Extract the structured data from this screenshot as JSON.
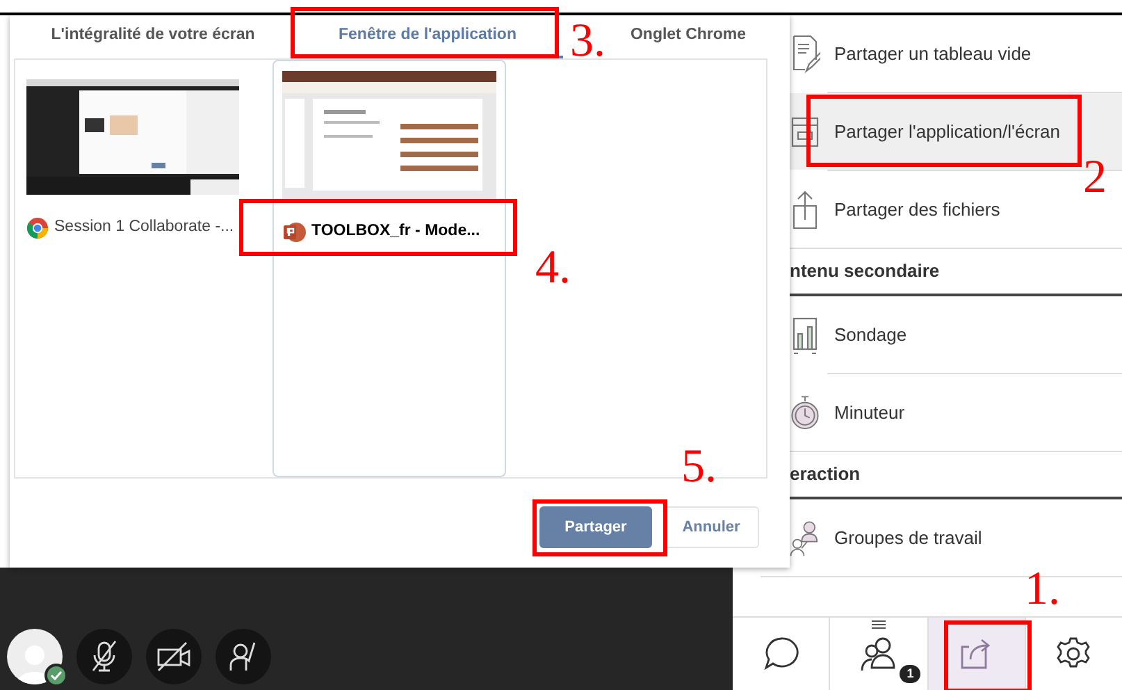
{
  "dialog": {
    "tabs": [
      {
        "label": "L'intégralité de votre écran",
        "selected": false
      },
      {
        "label": "Fenêtre de l'application",
        "selected": true
      },
      {
        "label": "Onglet Chrome",
        "selected": false
      }
    ],
    "windows": [
      {
        "kind": "chrome",
        "caption": "Session 1 Collaborate -...",
        "selected": false
      },
      {
        "kind": "powerpoint",
        "caption": "TOOLBOX_fr  -  Mode...",
        "selected": true
      }
    ],
    "buttons": [
      {
        "label": "Partager",
        "kind": "primary"
      },
      {
        "label": "Annuler",
        "kind": "secondary"
      }
    ]
  },
  "panel": {
    "items": [
      {
        "label": "Partager un tableau vide",
        "selected": false
      },
      {
        "label": "Partager l'application/l'écran",
        "selected": true
      },
      {
        "label": "Partager des fichiers",
        "selected": false
      }
    ],
    "sections": [
      {
        "title": "ntenu secondaire",
        "items": [
          {
            "label": "Sondage",
            "selected": false
          },
          {
            "label": "Minuteur",
            "selected": false
          }
        ]
      },
      {
        "title": "eraction",
        "items": [
          {
            "label": "Groupes de travail",
            "selected": false
          }
        ]
      }
    ]
  },
  "bottom_bar": {
    "buttons": [
      {
        "selected": false
      },
      {
        "selected": false,
        "badge": "1"
      },
      {
        "selected": true
      },
      {
        "selected": false
      }
    ]
  },
  "user": {
    "connected": true
  },
  "annotations": [
    {
      "label": "1."
    },
    {
      "label": "2"
    },
    {
      "label": "3."
    },
    {
      "label": "4."
    },
    {
      "label": "5."
    }
  ]
}
